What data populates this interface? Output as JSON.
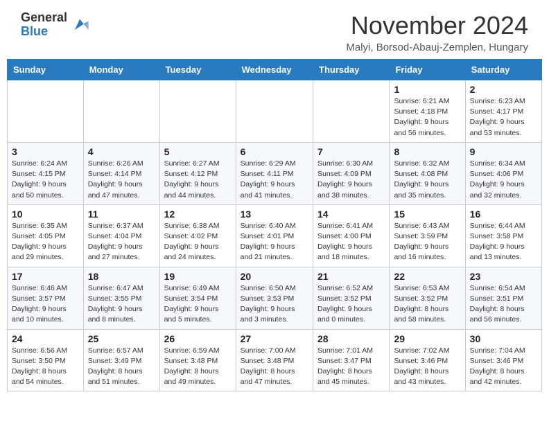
{
  "logo": {
    "general": "General",
    "blue": "Blue"
  },
  "title": "November 2024",
  "location": "Malyi, Borsod-Abauj-Zemplen, Hungary",
  "days_of_week": [
    "Sunday",
    "Monday",
    "Tuesday",
    "Wednesday",
    "Thursday",
    "Friday",
    "Saturday"
  ],
  "weeks": [
    [
      {
        "day": "",
        "info": ""
      },
      {
        "day": "",
        "info": ""
      },
      {
        "day": "",
        "info": ""
      },
      {
        "day": "",
        "info": ""
      },
      {
        "day": "",
        "info": ""
      },
      {
        "day": "1",
        "info": "Sunrise: 6:21 AM\nSunset: 4:18 PM\nDaylight: 9 hours and 56 minutes."
      },
      {
        "day": "2",
        "info": "Sunrise: 6:23 AM\nSunset: 4:17 PM\nDaylight: 9 hours and 53 minutes."
      }
    ],
    [
      {
        "day": "3",
        "info": "Sunrise: 6:24 AM\nSunset: 4:15 PM\nDaylight: 9 hours and 50 minutes."
      },
      {
        "day": "4",
        "info": "Sunrise: 6:26 AM\nSunset: 4:14 PM\nDaylight: 9 hours and 47 minutes."
      },
      {
        "day": "5",
        "info": "Sunrise: 6:27 AM\nSunset: 4:12 PM\nDaylight: 9 hours and 44 minutes."
      },
      {
        "day": "6",
        "info": "Sunrise: 6:29 AM\nSunset: 4:11 PM\nDaylight: 9 hours and 41 minutes."
      },
      {
        "day": "7",
        "info": "Sunrise: 6:30 AM\nSunset: 4:09 PM\nDaylight: 9 hours and 38 minutes."
      },
      {
        "day": "8",
        "info": "Sunrise: 6:32 AM\nSunset: 4:08 PM\nDaylight: 9 hours and 35 minutes."
      },
      {
        "day": "9",
        "info": "Sunrise: 6:34 AM\nSunset: 4:06 PM\nDaylight: 9 hours and 32 minutes."
      }
    ],
    [
      {
        "day": "10",
        "info": "Sunrise: 6:35 AM\nSunset: 4:05 PM\nDaylight: 9 hours and 29 minutes."
      },
      {
        "day": "11",
        "info": "Sunrise: 6:37 AM\nSunset: 4:04 PM\nDaylight: 9 hours and 27 minutes."
      },
      {
        "day": "12",
        "info": "Sunrise: 6:38 AM\nSunset: 4:02 PM\nDaylight: 9 hours and 24 minutes."
      },
      {
        "day": "13",
        "info": "Sunrise: 6:40 AM\nSunset: 4:01 PM\nDaylight: 9 hours and 21 minutes."
      },
      {
        "day": "14",
        "info": "Sunrise: 6:41 AM\nSunset: 4:00 PM\nDaylight: 9 hours and 18 minutes."
      },
      {
        "day": "15",
        "info": "Sunrise: 6:43 AM\nSunset: 3:59 PM\nDaylight: 9 hours and 16 minutes."
      },
      {
        "day": "16",
        "info": "Sunrise: 6:44 AM\nSunset: 3:58 PM\nDaylight: 9 hours and 13 minutes."
      }
    ],
    [
      {
        "day": "17",
        "info": "Sunrise: 6:46 AM\nSunset: 3:57 PM\nDaylight: 9 hours and 10 minutes."
      },
      {
        "day": "18",
        "info": "Sunrise: 6:47 AM\nSunset: 3:55 PM\nDaylight: 9 hours and 8 minutes."
      },
      {
        "day": "19",
        "info": "Sunrise: 6:49 AM\nSunset: 3:54 PM\nDaylight: 9 hours and 5 minutes."
      },
      {
        "day": "20",
        "info": "Sunrise: 6:50 AM\nSunset: 3:53 PM\nDaylight: 9 hours and 3 minutes."
      },
      {
        "day": "21",
        "info": "Sunrise: 6:52 AM\nSunset: 3:52 PM\nDaylight: 9 hours and 0 minutes."
      },
      {
        "day": "22",
        "info": "Sunrise: 6:53 AM\nSunset: 3:52 PM\nDaylight: 8 hours and 58 minutes."
      },
      {
        "day": "23",
        "info": "Sunrise: 6:54 AM\nSunset: 3:51 PM\nDaylight: 8 hours and 56 minutes."
      }
    ],
    [
      {
        "day": "24",
        "info": "Sunrise: 6:56 AM\nSunset: 3:50 PM\nDaylight: 8 hours and 54 minutes."
      },
      {
        "day": "25",
        "info": "Sunrise: 6:57 AM\nSunset: 3:49 PM\nDaylight: 8 hours and 51 minutes."
      },
      {
        "day": "26",
        "info": "Sunrise: 6:59 AM\nSunset: 3:48 PM\nDaylight: 8 hours and 49 minutes."
      },
      {
        "day": "27",
        "info": "Sunrise: 7:00 AM\nSunset: 3:48 PM\nDaylight: 8 hours and 47 minutes."
      },
      {
        "day": "28",
        "info": "Sunrise: 7:01 AM\nSunset: 3:47 PM\nDaylight: 8 hours and 45 minutes."
      },
      {
        "day": "29",
        "info": "Sunrise: 7:02 AM\nSunset: 3:46 PM\nDaylight: 8 hours and 43 minutes."
      },
      {
        "day": "30",
        "info": "Sunrise: 7:04 AM\nSunset: 3:46 PM\nDaylight: 8 hours and 42 minutes."
      }
    ]
  ]
}
